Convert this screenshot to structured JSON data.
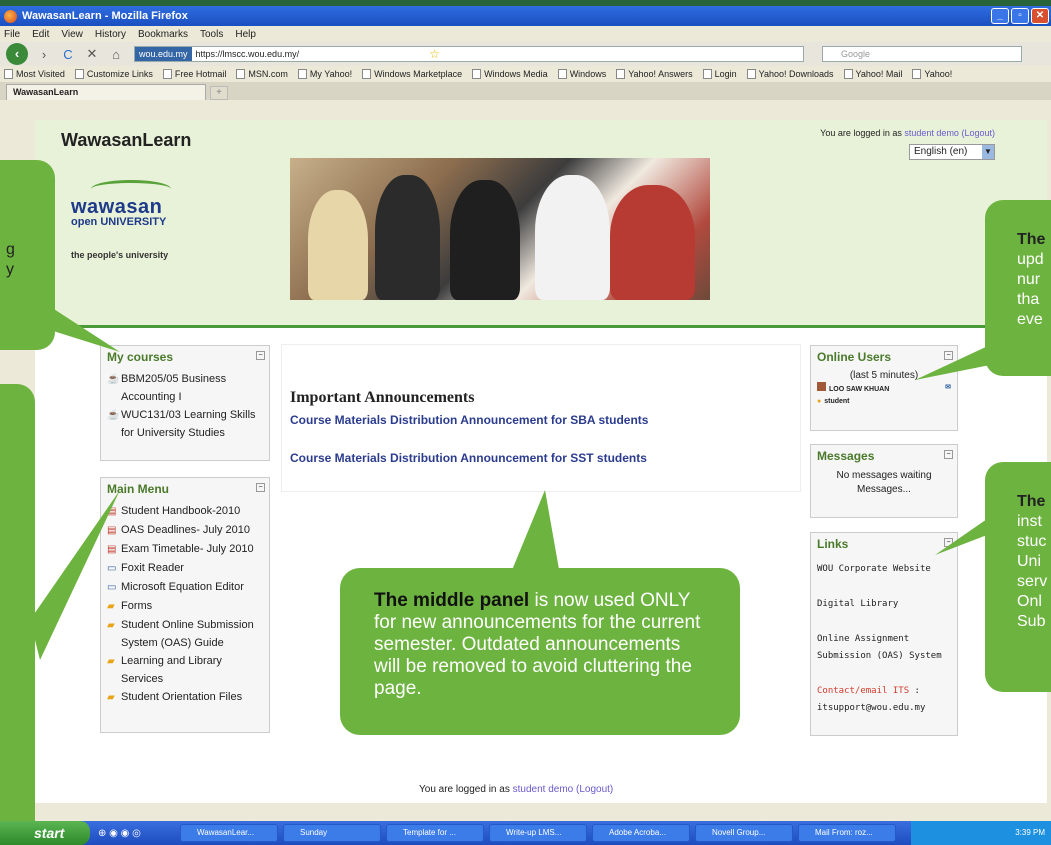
{
  "browser": {
    "window_title": "WawasanLearn - Mozilla Firefox",
    "menu": [
      "File",
      "Edit",
      "View",
      "History",
      "Bookmarks",
      "Tools",
      "Help"
    ],
    "url_badge": "wou.edu.my",
    "url": "https://lmscc.wou.edu.my/",
    "search_placeholder": "Google",
    "bookmarks": [
      "Most Visited",
      "Customize Links",
      "Free Hotmail",
      "MSN.com",
      "My Yahoo!",
      "Windows Marketplace",
      "Windows Media",
      "Windows",
      "Yahoo! Answers",
      "Login",
      "Yahoo! Downloads",
      "Yahoo! Mail",
      "Yahoo!"
    ],
    "tab_title": "WawasanLearn"
  },
  "header": {
    "site_title": "WawasanLearn",
    "logo_line1": "wawasan",
    "logo_line2": "open UNIVERSITY",
    "logo_tagline": "the people's university",
    "login_prefix": "You are logged in as",
    "login_user": "student demo",
    "logout": "(Logout)",
    "language": "English (en)"
  },
  "my_courses": {
    "title": "My courses",
    "items": [
      "BBM205/05 Business Accounting I",
      "WUC131/03 Learning Skills for University Studies"
    ]
  },
  "main_menu": {
    "title": "Main Menu",
    "items": [
      {
        "label": "Student Handbook-2010",
        "icon": "pdf-icon"
      },
      {
        "label": "OAS Deadlines- July 2010",
        "icon": "pdf-icon"
      },
      {
        "label": "Exam Timetable- July 2010",
        "icon": "pdf-icon"
      },
      {
        "label": "Foxit Reader",
        "icon": "window-icon"
      },
      {
        "label": "Microsoft Equation Editor",
        "icon": "window-icon"
      },
      {
        "label": "Forms",
        "icon": "folder-icon"
      },
      {
        "label": "Student Online Submission System (OAS) Guide",
        "icon": "folder-icon"
      },
      {
        "label": "Learning and Library Services",
        "icon": "folder-icon"
      },
      {
        "label": "Student Orientation Files",
        "icon": "folder-icon"
      }
    ]
  },
  "center": {
    "title": "Important Announcements",
    "links": [
      "Course Materials Distribution Announcement for SBA students",
      "Course Materials Distribution Announcement for SST students"
    ]
  },
  "online_users": {
    "title": "Online Users",
    "subtitle": "(last 5 minutes)",
    "user": "LOO SAW KHUAN",
    "user2": "student"
  },
  "messages": {
    "title": "Messages",
    "status": "No messages waiting",
    "link": "Messages..."
  },
  "links": {
    "title": "Links",
    "items": [
      "WOU Corporate Website",
      "Digital Library",
      "Online Assignment Submission (OAS) System"
    ],
    "contact_label": "Contact/email ITS",
    "contact_sep": " :",
    "contact_email": "itsupport@wou.edu.my"
  },
  "footer": {
    "login_prefix": "You are logged in as",
    "login_user": "student demo",
    "logout": "(Logout)"
  },
  "callouts": {
    "main_bold": "The middle panel",
    "main_rest": " is now used ONLY for new announcements for the current semester. Outdated announcements will be removed to avoid cluttering the page.",
    "right_top_lines": [
      "The",
      "upd",
      "nur",
      "tha",
      "eve"
    ],
    "right_bottom_lines": [
      "The",
      "inst",
      "stuc",
      "Uni",
      "serv",
      "Onl",
      "Sub"
    ],
    "left_top_lines": [
      "g",
      "y"
    ]
  },
  "taskbar": {
    "start": "start",
    "tasks": [
      "WawasanLear...",
      "Sunday",
      "Template for ...",
      "Write-up LMS...",
      "Adobe Acroba...",
      "Novell Group...",
      "Mail From: roz..."
    ],
    "clock": "3:39 PM"
  },
  "colors": {
    "accent_green": "#6db33f",
    "header_bg": "#e8f2d8",
    "link_blue": "#2b3c8f"
  }
}
